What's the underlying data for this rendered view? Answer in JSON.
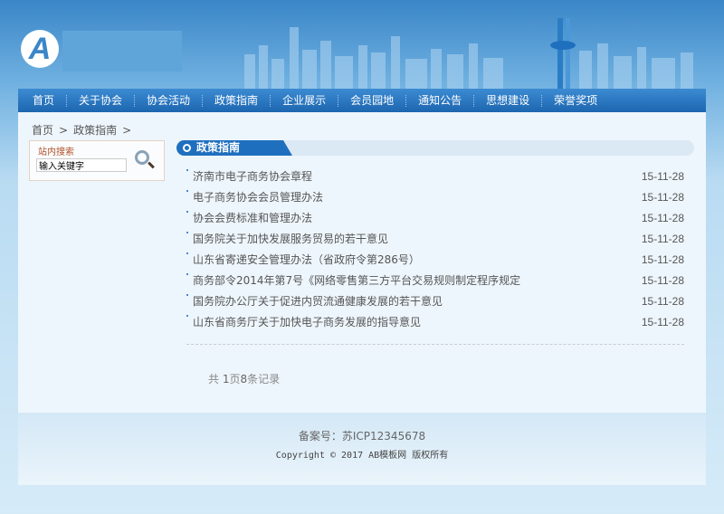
{
  "header": {
    "logo_letter": "A"
  },
  "nav": [
    "首页",
    "关于协会",
    "协会活动",
    "政策指南",
    "企业展示",
    "会员园地",
    "通知公告",
    "思想建设",
    "荣誉奖项"
  ],
  "breadcrumb": [
    "首页",
    ">",
    "政策指南",
    ">"
  ],
  "search": {
    "title": "站内搜索",
    "value": "输入关键字"
  },
  "section": {
    "title": "政策指南"
  },
  "articles": [
    {
      "title": "济南市电子商务协会章程",
      "date": "15-11-28"
    },
    {
      "title": "电子商务协会会员管理办法",
      "date": "15-11-28"
    },
    {
      "title": "协会会费标准和管理办法",
      "date": "15-11-28"
    },
    {
      "title": "国务院关于加快发展服务贸易的若干意见",
      "date": "15-11-28"
    },
    {
      "title": "山东省寄递安全管理办法（省政府令第286号）",
      "date": "15-11-28"
    },
    {
      "title": "商务部令2014年第7号《网络零售第三方平台交易规则制定程序规定",
      "date": "15-11-28"
    },
    {
      "title": "国务院办公厅关于促进内贸流通健康发展的若干意见",
      "date": "15-11-28"
    },
    {
      "title": "山东省商务厅关于加快电子商务发展的指导意见",
      "date": "15-11-28"
    }
  ],
  "pager": {
    "pre": "共 ",
    "pages": "1",
    "mid": "页",
    "count": "8",
    "post": "条记录"
  },
  "footer": {
    "icp": "备案号：苏ICP12345678",
    "copyright": "Copyright © 2017 AB模板网 版权所有"
  }
}
